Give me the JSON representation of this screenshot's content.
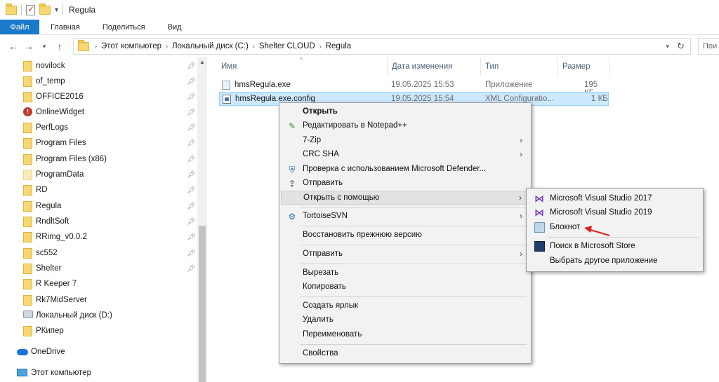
{
  "window": {
    "title": "Regula"
  },
  "ribbon": {
    "tabs": [
      "Файл",
      "Главная",
      "Поделиться",
      "Вид"
    ]
  },
  "address": {
    "crumbs": [
      "Этот компьютер",
      "Локальный диск (C:)",
      "Shelter CLOUD",
      "Regula"
    ],
    "search_placeholder": "Пои"
  },
  "nav": {
    "items": [
      {
        "label": "novilock",
        "icon": "folder-icon",
        "pinned": true
      },
      {
        "label": "of_temp",
        "icon": "folder-icon",
        "pinned": true
      },
      {
        "label": "OFFICE2016",
        "icon": "folder-icon",
        "pinned": true
      },
      {
        "label": "OnlineWidget",
        "icon": "red-app-icon",
        "pinned": true
      },
      {
        "label": "PerfLogs",
        "icon": "folder-icon",
        "pinned": true
      },
      {
        "label": "Program Files",
        "icon": "folder-icon",
        "pinned": true
      },
      {
        "label": "Program Files (x86)",
        "icon": "folder-icon",
        "pinned": true
      },
      {
        "label": "ProgramData",
        "icon": "folder-light-icon",
        "pinned": true
      },
      {
        "label": "RD",
        "icon": "folder-icon",
        "pinned": true
      },
      {
        "label": "Regula",
        "icon": "folder-icon",
        "pinned": true
      },
      {
        "label": "RndltSoft",
        "icon": "folder-icon",
        "pinned": true
      },
      {
        "label": "RRimg_v0.0.2",
        "icon": "folder-icon",
        "pinned": true
      },
      {
        "label": "sc552",
        "icon": "folder-icon",
        "pinned": true
      },
      {
        "label": "Shelter",
        "icon": "folder-icon",
        "pinned": true
      },
      {
        "label": "R Keeper 7",
        "icon": "folder-icon",
        "pinned": false
      },
      {
        "label": "Rk7MidServer",
        "icon": "folder-icon",
        "pinned": false
      },
      {
        "label": "Локальный диск (D:)",
        "icon": "drive-icon",
        "pinned": false
      },
      {
        "label": "РКипер",
        "icon": "folder-icon",
        "pinned": false
      }
    ],
    "onedrive": "OneDrive",
    "this_pc": "Этот компьютер"
  },
  "columns": {
    "name": "Имя",
    "modified": "Дата изменения",
    "type": "Тип",
    "size": "Размер"
  },
  "files": [
    {
      "name": "hmsRegula.exe",
      "modified": "19.05.2025 15:53",
      "type": "Приложение",
      "size": "195 КБ",
      "selected": false
    },
    {
      "name": "hmsRegula.exe.config",
      "modified": "19.05.2025 15:54",
      "type": "XML Configuratio...",
      "size": "1 КБ",
      "selected": true
    }
  ],
  "context_menu": {
    "open": "Открыть",
    "edit_npp": "Редактировать в Notepad++",
    "seven_zip": "7-Zip",
    "crc_sha": "CRC SHA",
    "defender": "Проверка с использованием Microsoft Defender...",
    "share": "Отправить",
    "open_with": "Открыть с помощью",
    "tortoise": "TortoiseSVN",
    "restore": "Восстановить прежнюю версию",
    "send_to": "Отправить",
    "cut": "Вырезать",
    "copy": "Копировать",
    "shortcut": "Создать ярлык",
    "delete": "Удалить",
    "rename": "Переименовать",
    "properties": "Свойства"
  },
  "open_with_menu": {
    "vs2017": "Microsoft Visual Studio 2017",
    "vs2019": "Microsoft Visual Studio 2019",
    "notepad": "Блокнот",
    "store": "Поиск в Microsoft Store",
    "other": "Выбрать другое приложение"
  },
  "colors": {
    "accent": "#1979ca",
    "selection": "#cce8ff",
    "annotation_arrow": "#e02020"
  }
}
